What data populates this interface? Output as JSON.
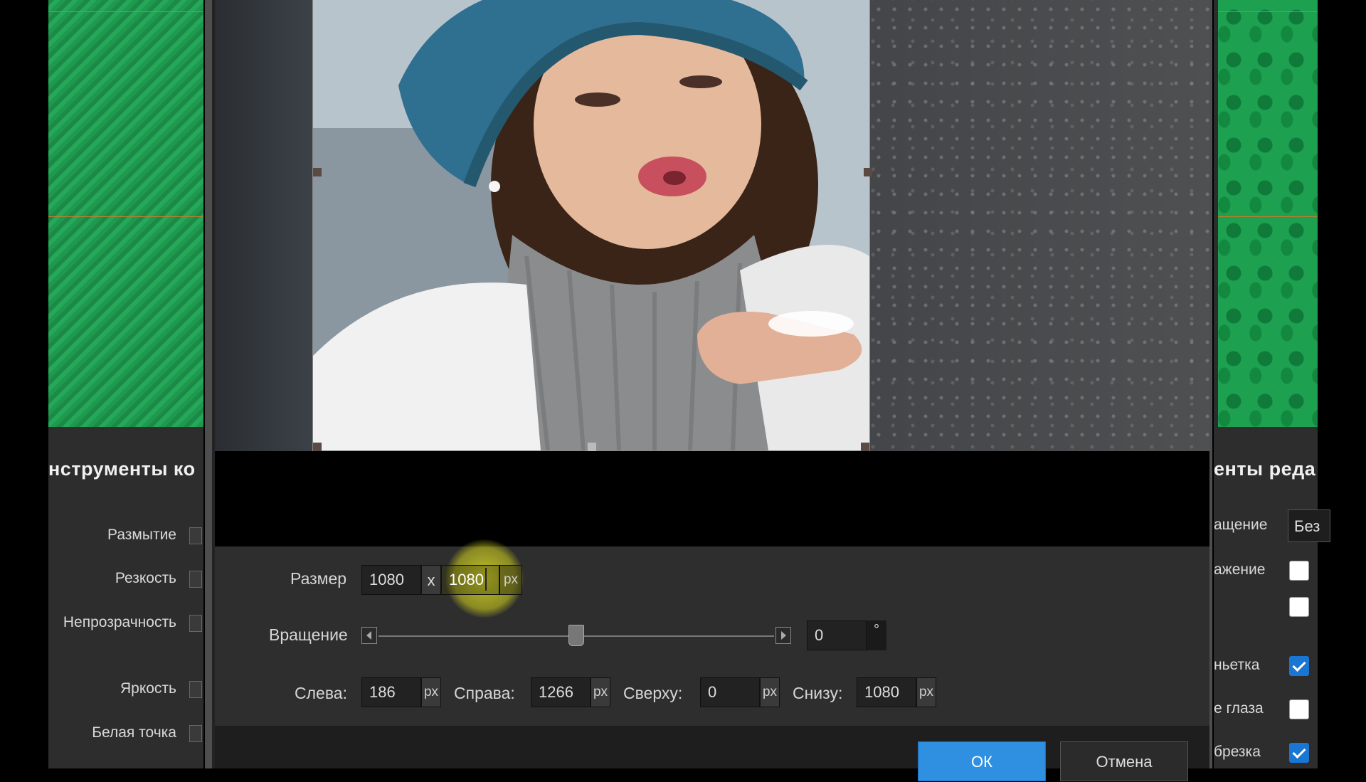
{
  "left_panel": {
    "title": "нструменты ко",
    "items": [
      {
        "label": "Размытие"
      },
      {
        "label": "Резкость"
      },
      {
        "label": "Непрозрачность"
      },
      {
        "label": "Яркость"
      },
      {
        "label": "Белая точка"
      }
    ]
  },
  "right_panel": {
    "title": "енты реда",
    "rotation_label": "ащение",
    "rotation_value": "Без",
    "items": [
      {
        "label": "ажение",
        "checked": false
      },
      {
        "label": "",
        "checked": false
      },
      {
        "label": "ньетка",
        "checked": true
      },
      {
        "label": "е глаза",
        "checked": false
      },
      {
        "label": "брезка",
        "checked": true
      }
    ]
  },
  "crop_dialog": {
    "size": {
      "label": "Размер",
      "width": "1080",
      "separator": "x",
      "height": "1080",
      "unit": "px"
    },
    "rotation": {
      "label": "Вращение",
      "value": "0",
      "unit": "°",
      "slider_fraction": 0.5
    },
    "offsets": {
      "left": {
        "label": "Слева:",
        "value": "186",
        "unit": "px"
      },
      "right": {
        "label": "Справа:",
        "value": "1266",
        "unit": "px"
      },
      "top": {
        "label": "Сверху:",
        "value": "0",
        "unit": "px"
      },
      "bottom": {
        "label": "Снизу:",
        "value": "1080",
        "unit": "px"
      }
    },
    "ok_label": "ОК",
    "cancel_label": "Отмена"
  },
  "icons": {
    "slider_left": "arrow-left-icon",
    "slider_right": "arrow-right-icon",
    "checkbox_checked": "checkmark-icon"
  },
  "colors": {
    "accent": "#2f8fe0",
    "background_pattern": "#1da050",
    "highlight": "#d8d83a"
  }
}
